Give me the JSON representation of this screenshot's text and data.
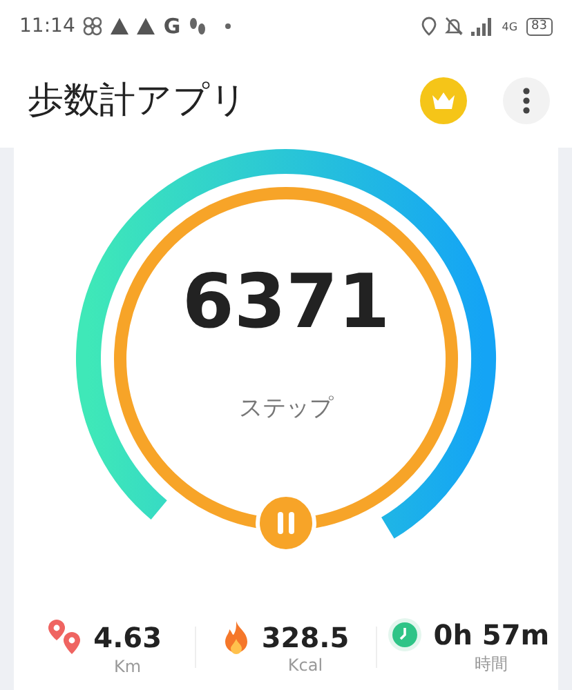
{
  "status_bar": {
    "time": "11:14",
    "notification_letter": "G",
    "network": "4G",
    "battery": "83"
  },
  "header": {
    "title": "歩数計アプリ"
  },
  "gauge": {
    "steps": "6371",
    "unit": "ステップ",
    "paused": false
  },
  "stats": [
    {
      "kind": "distance",
      "value": "4.63",
      "unit": "Km"
    },
    {
      "kind": "calories",
      "value": "328.5",
      "unit": "Kcal"
    },
    {
      "kind": "duration",
      "value": "0h 57m",
      "unit": "時間"
    }
  ]
}
